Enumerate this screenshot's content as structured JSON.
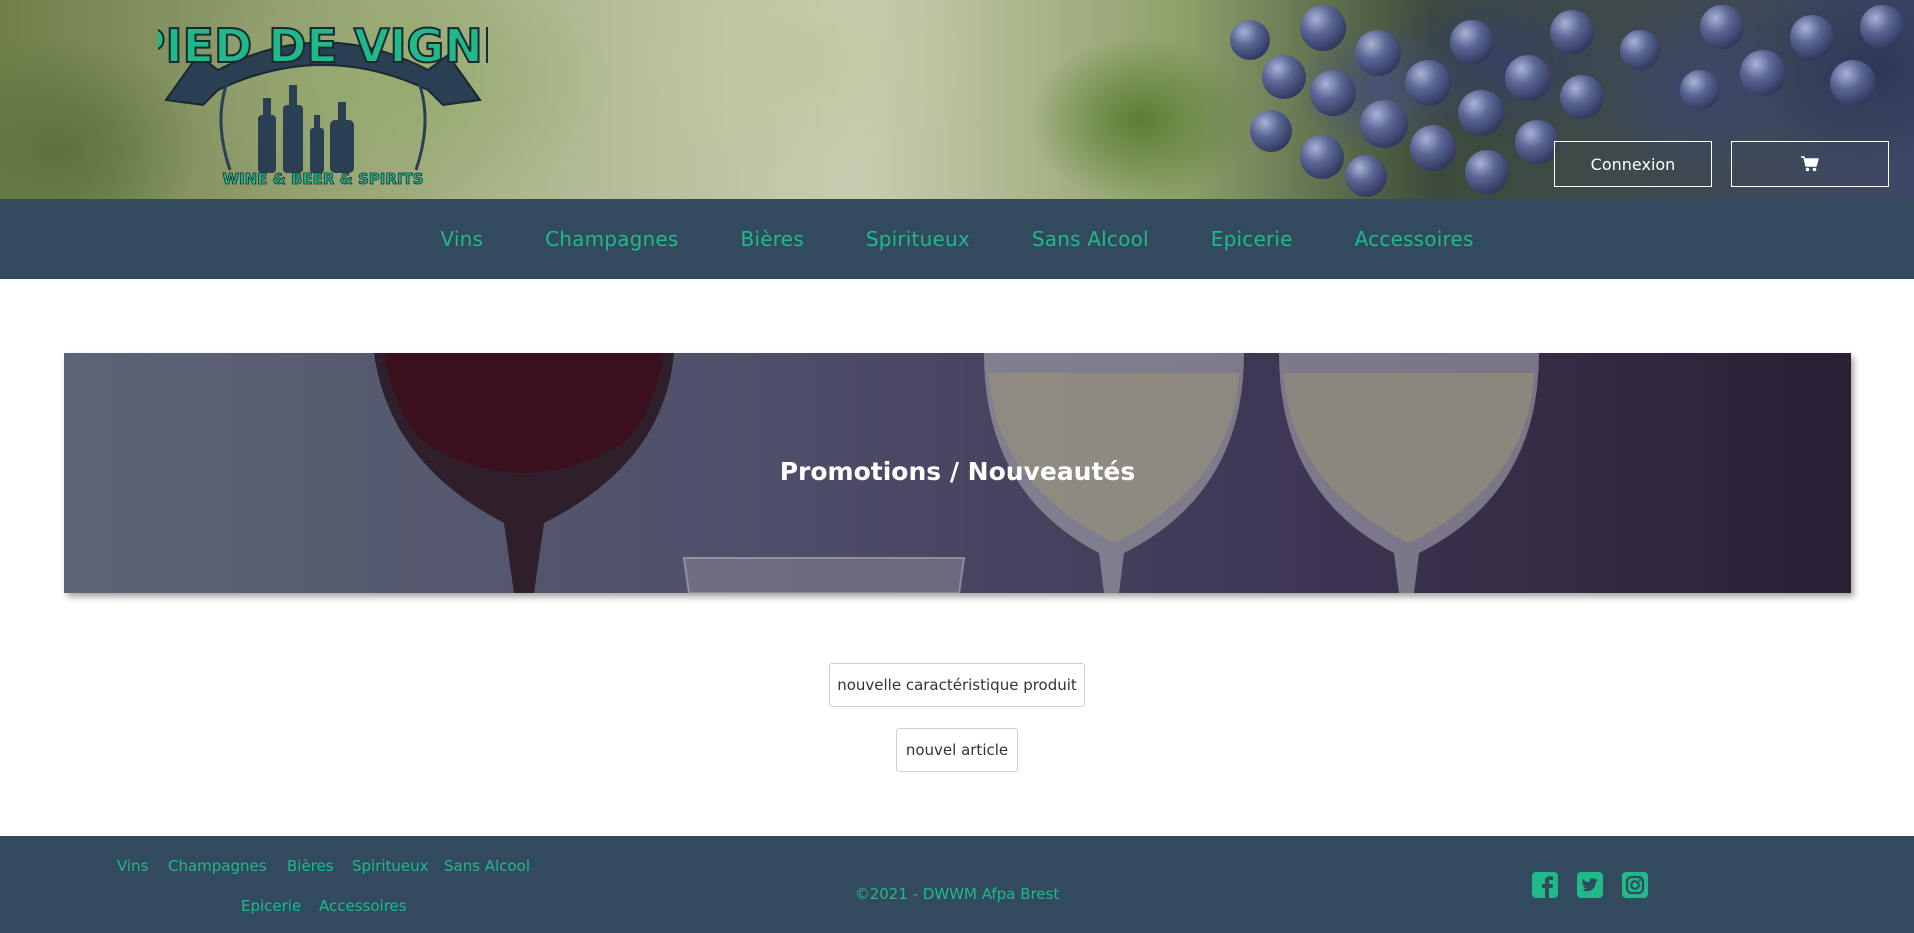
{
  "header": {
    "logo": {
      "title": "PIED DE VIGNE",
      "subtitle": "WINE & BEER & SPIRITS"
    },
    "login_label": "Connexion",
    "cart_icon": "shopping-cart-icon"
  },
  "nav": {
    "items": [
      "Vins",
      "Champagnes",
      "Bières",
      "Spiritueux",
      "Sans Alcool",
      "Epicerie",
      "Accessoires"
    ]
  },
  "banner": {
    "title": "Promotions / Nouveautés"
  },
  "actions": {
    "new_feature_label": "nouvelle caractéristique produit",
    "new_article_label": "nouvel article"
  },
  "footer": {
    "links": [
      "Vins",
      "Champagnes",
      "Bières",
      "Spiritueux",
      "Sans Alcool",
      "Epicerie",
      "Accessoires"
    ],
    "copyright": "©2021 - DWWM Afpa Brest",
    "social": [
      "facebook-icon",
      "twitter-icon",
      "instagram-icon"
    ]
  },
  "colors": {
    "navy": "#314a5e",
    "accent_green": "#20b98a",
    "white": "#ffffff"
  }
}
